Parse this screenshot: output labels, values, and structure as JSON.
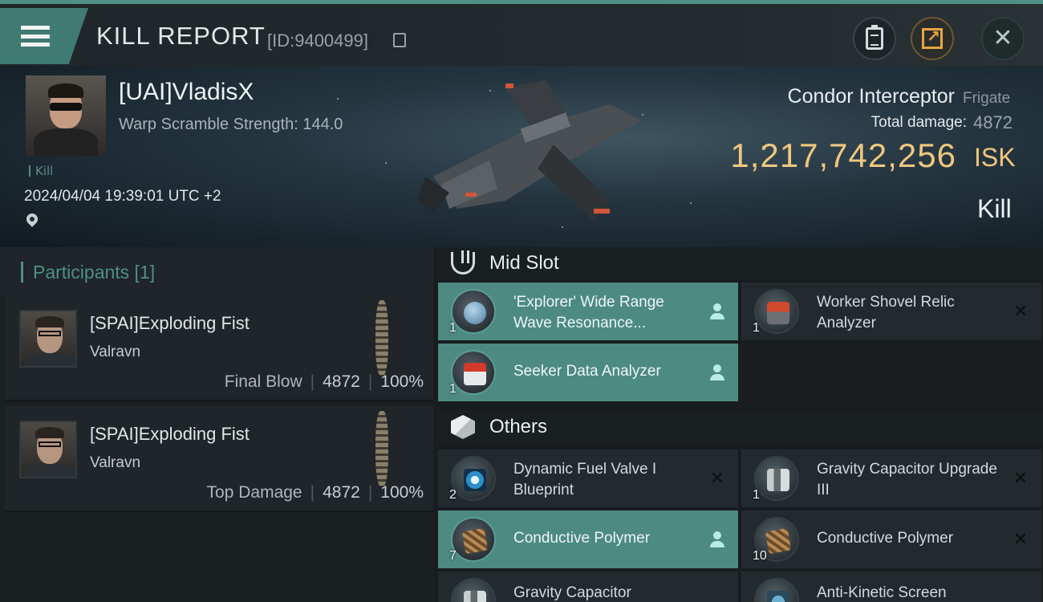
{
  "header": {
    "title": "KILL REPORT",
    "report_id": "[ID:9400499]",
    "menu_icon": "hamburger-icon",
    "buttons": [
      "clipboard-icon",
      "share-icon",
      "close-icon"
    ]
  },
  "victim": {
    "name": "[UAI]VladisX",
    "warp_scramble": "Warp Scramble Strength: 144.0",
    "tag": "Kill",
    "datetime": "2024/04/04 19:39:01 UTC +2",
    "ship_name": "Condor Interceptor",
    "ship_class": "Frigate",
    "total_damage_label": "Total damage:",
    "total_damage_value": "4872",
    "isk_value": "1,217,742,256",
    "isk_unit": "ISK",
    "result": "Kill"
  },
  "participants": {
    "title": "Participants [1]",
    "rows": [
      {
        "name": "[SPAI]Exploding Fist",
        "corp": "Valravn",
        "label": "Final Blow",
        "damage": "4872",
        "percent": "100%"
      },
      {
        "name": "[SPAI]Exploding Fist",
        "corp": "Valravn",
        "label": "Top Damage",
        "damage": "4872",
        "percent": "100%"
      }
    ]
  },
  "sections": {
    "mid_slot": "Mid Slot",
    "others": "Others"
  },
  "mid_items": [
    {
      "qty": "1",
      "name": "'Explorer' Wide Range Wave Resonance...",
      "status": "dropped",
      "icon": "globe-icon"
    },
    {
      "qty": "1",
      "name": "Worker Shovel Relic Analyzer",
      "status": "destroyed",
      "icon": "relic-analyzer-icon"
    },
    {
      "qty": "1",
      "name": "Seeker Data Analyzer",
      "status": "dropped",
      "icon": "data-analyzer-icon"
    }
  ],
  "other_items": [
    {
      "qty": "2",
      "name": "Dynamic Fuel Valve I Blueprint",
      "status": "destroyed",
      "icon": "blueprint-icon"
    },
    {
      "qty": "1",
      "name": "Gravity Capacitor Upgrade III",
      "status": "destroyed",
      "icon": "gravity-capacitor-icon"
    },
    {
      "qty": "7",
      "name": "Conductive Polymer",
      "status": "dropped",
      "icon": "polymer-icon"
    },
    {
      "qty": "10",
      "name": "Conductive Polymer",
      "status": "destroyed",
      "icon": "polymer-icon"
    },
    {
      "qty": "",
      "name": "Gravity Capacitor",
      "status": "",
      "icon": "gravity-capacitor-icon"
    },
    {
      "qty": "",
      "name": "Anti-Kinetic Screen",
      "status": "",
      "icon": "screen-icon"
    }
  ],
  "colors": {
    "accent": "#4e8f86",
    "isk": "#f0c77e",
    "highlight_row": "#4c8a82"
  }
}
